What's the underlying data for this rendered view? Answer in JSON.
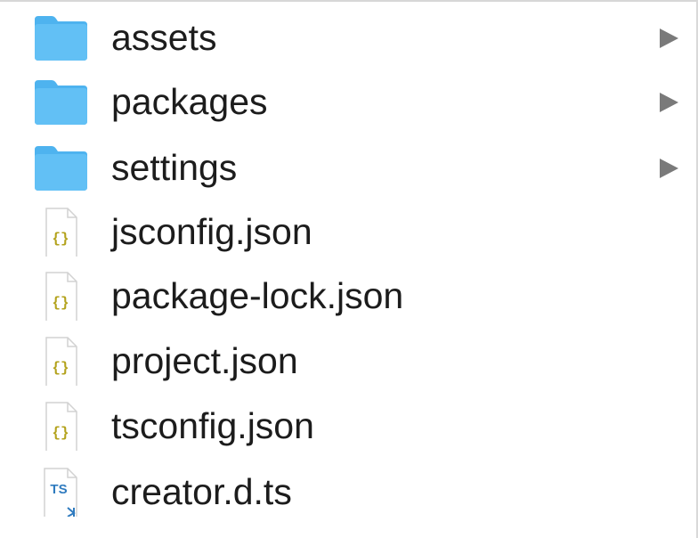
{
  "items": [
    {
      "label": "assets",
      "kind": "folder",
      "icon": "folder-icon",
      "expandable": true
    },
    {
      "label": "packages",
      "kind": "folder",
      "icon": "folder-icon",
      "expandable": true
    },
    {
      "label": "settings",
      "kind": "folder",
      "icon": "folder-icon",
      "expandable": true
    },
    {
      "label": "jsconfig.json",
      "kind": "json",
      "icon": "json-file-icon",
      "expandable": false
    },
    {
      "label": "package-lock.json",
      "kind": "json",
      "icon": "json-file-icon",
      "expandable": false
    },
    {
      "label": "project.json",
      "kind": "json",
      "icon": "json-file-icon",
      "expandable": false
    },
    {
      "label": "tsconfig.json",
      "kind": "json",
      "icon": "json-file-icon",
      "expandable": false
    },
    {
      "label": "creator.d.ts",
      "kind": "typescript",
      "icon": "typescript-file-icon",
      "expandable": false
    }
  ],
  "icon_glyphs": {
    "json": "{}",
    "typescript": "TS"
  },
  "colors": {
    "folder": "#62c0f5",
    "folder_tab": "#4eb3ef",
    "json_braces": "#b3a21c",
    "ts_text": "#2f7bbf",
    "chevron": "#7a7a7a"
  }
}
